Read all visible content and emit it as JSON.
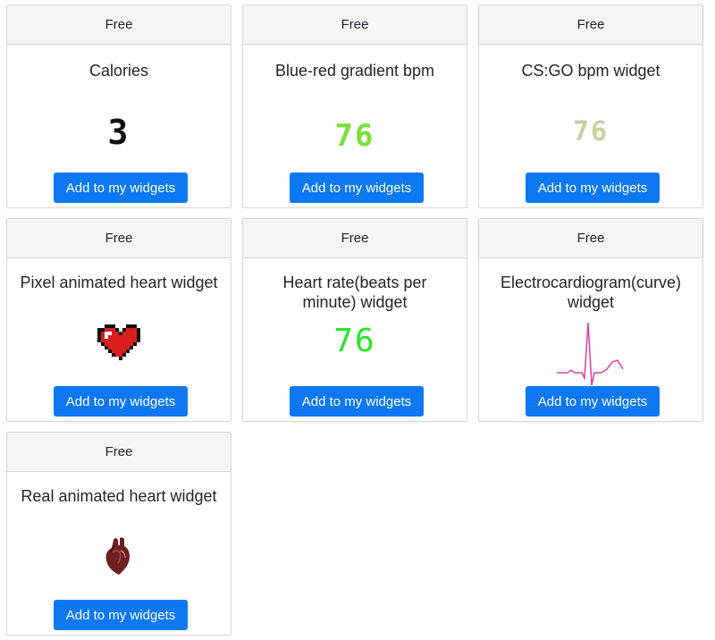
{
  "widgets": [
    {
      "price": "Free",
      "title": "Calories",
      "value": "3",
      "button": "Add to my widgets"
    },
    {
      "price": "Free",
      "title": "Blue-red gradient bpm",
      "value": "76",
      "button": "Add to my widgets"
    },
    {
      "price": "Free",
      "title": "CS:GO bpm widget",
      "value": "76",
      "button": "Add to my widgets"
    },
    {
      "price": "Free",
      "title": "Pixel animated heart widget",
      "button": "Add to my widgets"
    },
    {
      "price": "Free",
      "title": "Heart rate(beats per minute) widget",
      "value": "76",
      "button": "Add to my widgets"
    },
    {
      "price": "Free",
      "title": "Electrocardiogram(curve) widget",
      "button": "Add to my widgets"
    },
    {
      "price": "Free",
      "title": "Real animated heart widget",
      "button": "Add to my widgets"
    }
  ],
  "colors": {
    "button": "#0d78f2",
    "gradient_bpm": "#7be03a",
    "csgo_bpm": "#c8cfa1",
    "heart_rate": "#22e822",
    "ecg_line": "#e23d9c",
    "pixel_heart": "#d91e1e"
  }
}
